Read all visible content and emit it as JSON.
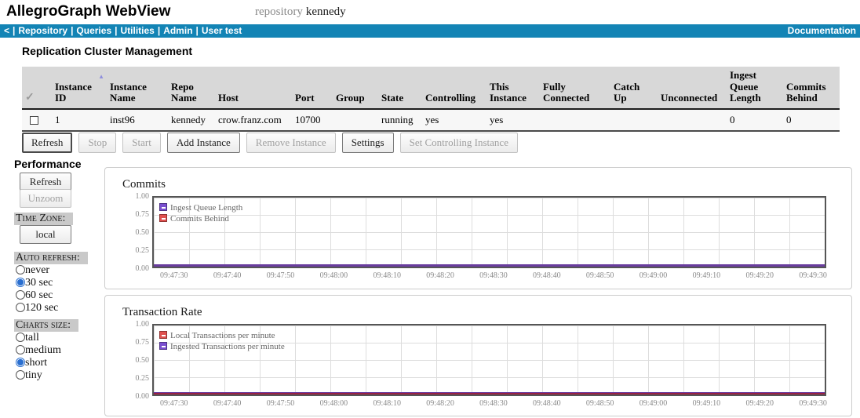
{
  "header": {
    "app_title": "AllegroGraph WebView",
    "repository_label": "repository",
    "repository_name": "kennedy"
  },
  "nav": {
    "back": "<",
    "separator": "|",
    "items": [
      "Repository",
      "Queries",
      "Utilities",
      "Admin",
      "User test"
    ],
    "right": "Documentation"
  },
  "cluster": {
    "title": "Replication Cluster Management",
    "table": {
      "select_icon": "✓",
      "sort_icon": "▲",
      "columns": [
        "Instance ID",
        "Instance Name",
        "Repo Name",
        "Host",
        "Port",
        "Group",
        "State",
        "Controlling",
        "This Instance",
        "Fully Connected",
        "Catch Up",
        "Unconnected",
        "Ingest Queue Length",
        "Commits Behind"
      ],
      "row": {
        "instance_id": "1",
        "instance_name": "inst96",
        "repo_name": "kennedy",
        "host": "crow.franz.com",
        "port": "10700",
        "group": "",
        "state": "running",
        "controlling": "yes",
        "this_instance": "yes",
        "fully_connected": "",
        "catch_up": "",
        "unconnected": "",
        "ingest_queue_length": "0",
        "commits_behind": "0"
      }
    },
    "buttons": [
      {
        "label": "Refresh",
        "enabled": true
      },
      {
        "label": "Stop",
        "enabled": false
      },
      {
        "label": "Start",
        "enabled": false
      },
      {
        "label": "Add Instance",
        "enabled": true
      },
      {
        "label": "Remove Instance",
        "enabled": false
      },
      {
        "label": "Settings",
        "enabled": true
      },
      {
        "label": "Set Controlling Instance",
        "enabled": false
      }
    ]
  },
  "performance": {
    "title": "Performance",
    "refresh_label": "Refresh",
    "unzoom_label": "Unzoom",
    "time_zone_label": "Time Zone:",
    "time_zone_value": "local",
    "auto_refresh_label": "Auto refresh:",
    "auto_refresh_options": [
      {
        "label": "never",
        "selected": false
      },
      {
        "label": "30 sec",
        "selected": true
      },
      {
        "label": "60 sec",
        "selected": false
      },
      {
        "label": "120 sec",
        "selected": false
      }
    ],
    "charts_size_label": "Charts size:",
    "charts_size_options": [
      {
        "label": "tall",
        "selected": false
      },
      {
        "label": "medium",
        "selected": false
      },
      {
        "label": "short",
        "selected": true
      },
      {
        "label": "tiny",
        "selected": false
      }
    ]
  },
  "chart_data": [
    {
      "type": "line",
      "title": "Commits",
      "x": [
        "09:47:30",
        "09:47:40",
        "09:47:50",
        "09:48:00",
        "09:48:10",
        "09:48:20",
        "09:48:30",
        "09:48:40",
        "09:48:50",
        "09:49:00",
        "09:49:10",
        "09:49:20",
        "09:49:30"
      ],
      "series": [
        {
          "name": "Ingest Queue Length",
          "color": "#7a4fd0",
          "values": [
            0,
            0,
            0,
            0,
            0,
            0,
            0,
            0,
            0,
            0,
            0,
            0,
            0
          ]
        },
        {
          "name": "Commits Behind",
          "color": "#e0514f",
          "values": [
            0,
            0,
            0,
            0,
            0,
            0,
            0,
            0,
            0,
            0,
            0,
            0,
            0
          ]
        }
      ],
      "ylim": [
        0,
        1
      ],
      "yticks": [
        "1.00",
        "0.75",
        "0.50",
        "0.25",
        "0.00"
      ],
      "grid": true,
      "legend_position": "top-left"
    },
    {
      "type": "line",
      "title": "Transaction Rate",
      "x": [
        "09:47:30",
        "09:47:40",
        "09:47:50",
        "09:48:00",
        "09:48:10",
        "09:48:20",
        "09:48:30",
        "09:48:40",
        "09:48:50",
        "09:49:00",
        "09:49:10",
        "09:49:20",
        "09:49:30"
      ],
      "series": [
        {
          "name": "Local Transactions per minute",
          "color": "#e0514f",
          "values": [
            0,
            0,
            0,
            0,
            0,
            0,
            0,
            0,
            0,
            0,
            0,
            0,
            0
          ]
        },
        {
          "name": "Ingested Transactions per minute",
          "color": "#7a4fd0",
          "values": [
            0,
            0,
            0,
            0,
            0,
            0,
            0,
            0,
            0,
            0,
            0,
            0,
            0
          ]
        }
      ],
      "ylim": [
        0,
        1
      ],
      "yticks": [
        "1.00",
        "0.75",
        "0.50",
        "0.25",
        "0.00"
      ],
      "grid": true,
      "legend_position": "top-left"
    }
  ]
}
